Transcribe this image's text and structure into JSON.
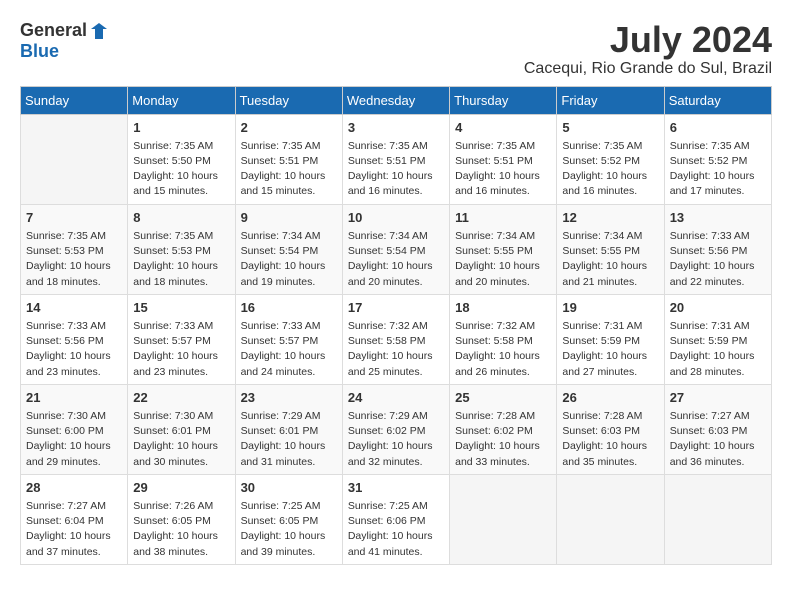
{
  "logo": {
    "general": "General",
    "blue": "Blue"
  },
  "title": {
    "month": "July 2024",
    "location": "Cacequi, Rio Grande do Sul, Brazil"
  },
  "days_of_week": [
    "Sunday",
    "Monday",
    "Tuesday",
    "Wednesday",
    "Thursday",
    "Friday",
    "Saturday"
  ],
  "weeks": [
    [
      {
        "num": "",
        "info": ""
      },
      {
        "num": "1",
        "info": "Sunrise: 7:35 AM\nSunset: 5:50 PM\nDaylight: 10 hours\nand 15 minutes."
      },
      {
        "num": "2",
        "info": "Sunrise: 7:35 AM\nSunset: 5:51 PM\nDaylight: 10 hours\nand 15 minutes."
      },
      {
        "num": "3",
        "info": "Sunrise: 7:35 AM\nSunset: 5:51 PM\nDaylight: 10 hours\nand 16 minutes."
      },
      {
        "num": "4",
        "info": "Sunrise: 7:35 AM\nSunset: 5:51 PM\nDaylight: 10 hours\nand 16 minutes."
      },
      {
        "num": "5",
        "info": "Sunrise: 7:35 AM\nSunset: 5:52 PM\nDaylight: 10 hours\nand 16 minutes."
      },
      {
        "num": "6",
        "info": "Sunrise: 7:35 AM\nSunset: 5:52 PM\nDaylight: 10 hours\nand 17 minutes."
      }
    ],
    [
      {
        "num": "7",
        "info": "Sunrise: 7:35 AM\nSunset: 5:53 PM\nDaylight: 10 hours\nand 18 minutes."
      },
      {
        "num": "8",
        "info": "Sunrise: 7:35 AM\nSunset: 5:53 PM\nDaylight: 10 hours\nand 18 minutes."
      },
      {
        "num": "9",
        "info": "Sunrise: 7:34 AM\nSunset: 5:54 PM\nDaylight: 10 hours\nand 19 minutes."
      },
      {
        "num": "10",
        "info": "Sunrise: 7:34 AM\nSunset: 5:54 PM\nDaylight: 10 hours\nand 20 minutes."
      },
      {
        "num": "11",
        "info": "Sunrise: 7:34 AM\nSunset: 5:55 PM\nDaylight: 10 hours\nand 20 minutes."
      },
      {
        "num": "12",
        "info": "Sunrise: 7:34 AM\nSunset: 5:55 PM\nDaylight: 10 hours\nand 21 minutes."
      },
      {
        "num": "13",
        "info": "Sunrise: 7:33 AM\nSunset: 5:56 PM\nDaylight: 10 hours\nand 22 minutes."
      }
    ],
    [
      {
        "num": "14",
        "info": "Sunrise: 7:33 AM\nSunset: 5:56 PM\nDaylight: 10 hours\nand 23 minutes."
      },
      {
        "num": "15",
        "info": "Sunrise: 7:33 AM\nSunset: 5:57 PM\nDaylight: 10 hours\nand 23 minutes."
      },
      {
        "num": "16",
        "info": "Sunrise: 7:33 AM\nSunset: 5:57 PM\nDaylight: 10 hours\nand 24 minutes."
      },
      {
        "num": "17",
        "info": "Sunrise: 7:32 AM\nSunset: 5:58 PM\nDaylight: 10 hours\nand 25 minutes."
      },
      {
        "num": "18",
        "info": "Sunrise: 7:32 AM\nSunset: 5:58 PM\nDaylight: 10 hours\nand 26 minutes."
      },
      {
        "num": "19",
        "info": "Sunrise: 7:31 AM\nSunset: 5:59 PM\nDaylight: 10 hours\nand 27 minutes."
      },
      {
        "num": "20",
        "info": "Sunrise: 7:31 AM\nSunset: 5:59 PM\nDaylight: 10 hours\nand 28 minutes."
      }
    ],
    [
      {
        "num": "21",
        "info": "Sunrise: 7:30 AM\nSunset: 6:00 PM\nDaylight: 10 hours\nand 29 minutes."
      },
      {
        "num": "22",
        "info": "Sunrise: 7:30 AM\nSunset: 6:01 PM\nDaylight: 10 hours\nand 30 minutes."
      },
      {
        "num": "23",
        "info": "Sunrise: 7:29 AM\nSunset: 6:01 PM\nDaylight: 10 hours\nand 31 minutes."
      },
      {
        "num": "24",
        "info": "Sunrise: 7:29 AM\nSunset: 6:02 PM\nDaylight: 10 hours\nand 32 minutes."
      },
      {
        "num": "25",
        "info": "Sunrise: 7:28 AM\nSunset: 6:02 PM\nDaylight: 10 hours\nand 33 minutes."
      },
      {
        "num": "26",
        "info": "Sunrise: 7:28 AM\nSunset: 6:03 PM\nDaylight: 10 hours\nand 35 minutes."
      },
      {
        "num": "27",
        "info": "Sunrise: 7:27 AM\nSunset: 6:03 PM\nDaylight: 10 hours\nand 36 minutes."
      }
    ],
    [
      {
        "num": "28",
        "info": "Sunrise: 7:27 AM\nSunset: 6:04 PM\nDaylight: 10 hours\nand 37 minutes."
      },
      {
        "num": "29",
        "info": "Sunrise: 7:26 AM\nSunset: 6:05 PM\nDaylight: 10 hours\nand 38 minutes."
      },
      {
        "num": "30",
        "info": "Sunrise: 7:25 AM\nSunset: 6:05 PM\nDaylight: 10 hours\nand 39 minutes."
      },
      {
        "num": "31",
        "info": "Sunrise: 7:25 AM\nSunset: 6:06 PM\nDaylight: 10 hours\nand 41 minutes."
      },
      {
        "num": "",
        "info": ""
      },
      {
        "num": "",
        "info": ""
      },
      {
        "num": "",
        "info": ""
      }
    ]
  ]
}
